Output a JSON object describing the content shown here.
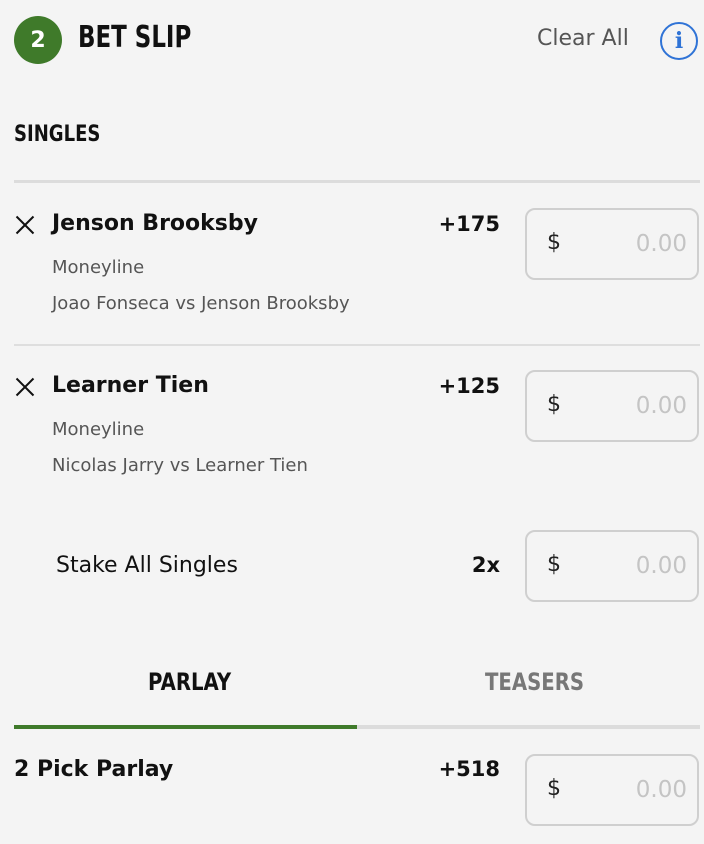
{
  "header": {
    "count": "2",
    "title": "BET SLIP",
    "clear_all": "Clear All",
    "info_glyph": "i"
  },
  "singles": {
    "section_title": "SINGLES",
    "bets": [
      {
        "selection": "Jenson Brooksby",
        "market": "Moneyline",
        "event": "Joao Fonseca vs Jenson Brooksby",
        "odds": "+175",
        "currency": "$",
        "stake_placeholder": "0.00"
      },
      {
        "selection": "Learner Tien",
        "market": "Moneyline",
        "event": "Nicolas Jarry vs Learner Tien",
        "odds": "+125",
        "currency": "$",
        "stake_placeholder": "0.00"
      }
    ],
    "stake_all": {
      "label": "Stake All Singles",
      "multiplier": "2x",
      "currency": "$",
      "stake_placeholder": "0.00"
    }
  },
  "tabs": [
    {
      "label": "PARLAY",
      "active": true
    },
    {
      "label": "TEASERS",
      "active": false
    }
  ],
  "parlay": {
    "name": "2 Pick Parlay",
    "odds": "+518",
    "currency": "$",
    "stake_placeholder": "0.00"
  },
  "colors": {
    "accent_green": "#3f7a2a",
    "info_blue": "#2f73d6",
    "background": "#f4f4f4"
  },
  "icons": {
    "remove": "close-icon",
    "info": "info-icon"
  }
}
